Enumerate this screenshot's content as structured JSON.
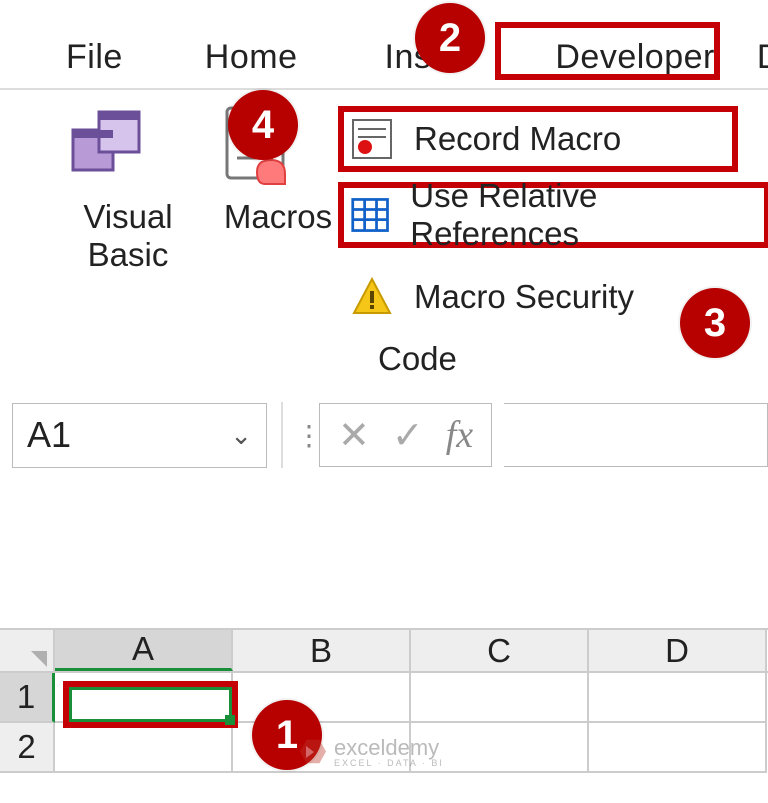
{
  "tabs": {
    "file": "File",
    "home": "Home",
    "insert_trunc": "Ins",
    "developer": "Developer",
    "d_trunc": "D"
  },
  "ribbon": {
    "visual_basic": "Visual\nBasic",
    "macros": "Macros",
    "record_macro": "Record Macro",
    "use_relative": "Use Relative References",
    "macro_security": "Macro Security",
    "group_label": "Code"
  },
  "namebox": {
    "value": "A1"
  },
  "fx": {
    "cancel": "✕",
    "enter": "✓",
    "label": "fx"
  },
  "colheads": [
    "A",
    "B",
    "C",
    "D"
  ],
  "rowheads": [
    "1",
    "2"
  ],
  "badges": {
    "b1": "1",
    "b2": "2",
    "b3": "3",
    "b4": "4"
  },
  "watermark": {
    "brand": "exceldemy",
    "sub": "EXCEL · DATA · BI"
  }
}
